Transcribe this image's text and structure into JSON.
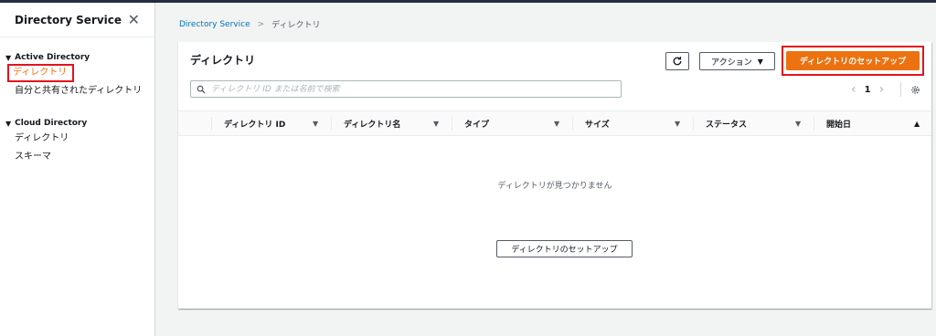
{
  "sidebar": {
    "title": "Directory Service",
    "close_glyph": "✕",
    "sections": [
      {
        "title": "Active Directory",
        "items": [
          "ディレクトリ",
          "自分と共有されたディレクトリ"
        ]
      },
      {
        "title": "Cloud Directory",
        "items": [
          "ディレクトリ",
          "スキーマ"
        ]
      }
    ]
  },
  "breadcrumb": {
    "root": "Directory Service",
    "separator": ">",
    "current": "ディレクトリ"
  },
  "panel": {
    "title": "ディレクトリ",
    "refresh_icon": "refresh-icon",
    "actions_label": "アクション",
    "primary_label": "ディレクトリのセットアップ",
    "search_placeholder": "ディレクトリ ID または名前で検索",
    "pagination": {
      "page": "1",
      "prev": "‹",
      "next": "›"
    }
  },
  "table": {
    "columns": [
      "ディレクトリ ID",
      "ディレクトリ名",
      "タイプ",
      "サイズ",
      "ステータス",
      "開始日"
    ],
    "empty_message": "ディレクトリが見つかりません",
    "empty_button": "ディレクトリのセットアップ"
  },
  "colors": {
    "accent": "#ec7211",
    "highlight": "#e0141e",
    "link": "#0073bb"
  }
}
